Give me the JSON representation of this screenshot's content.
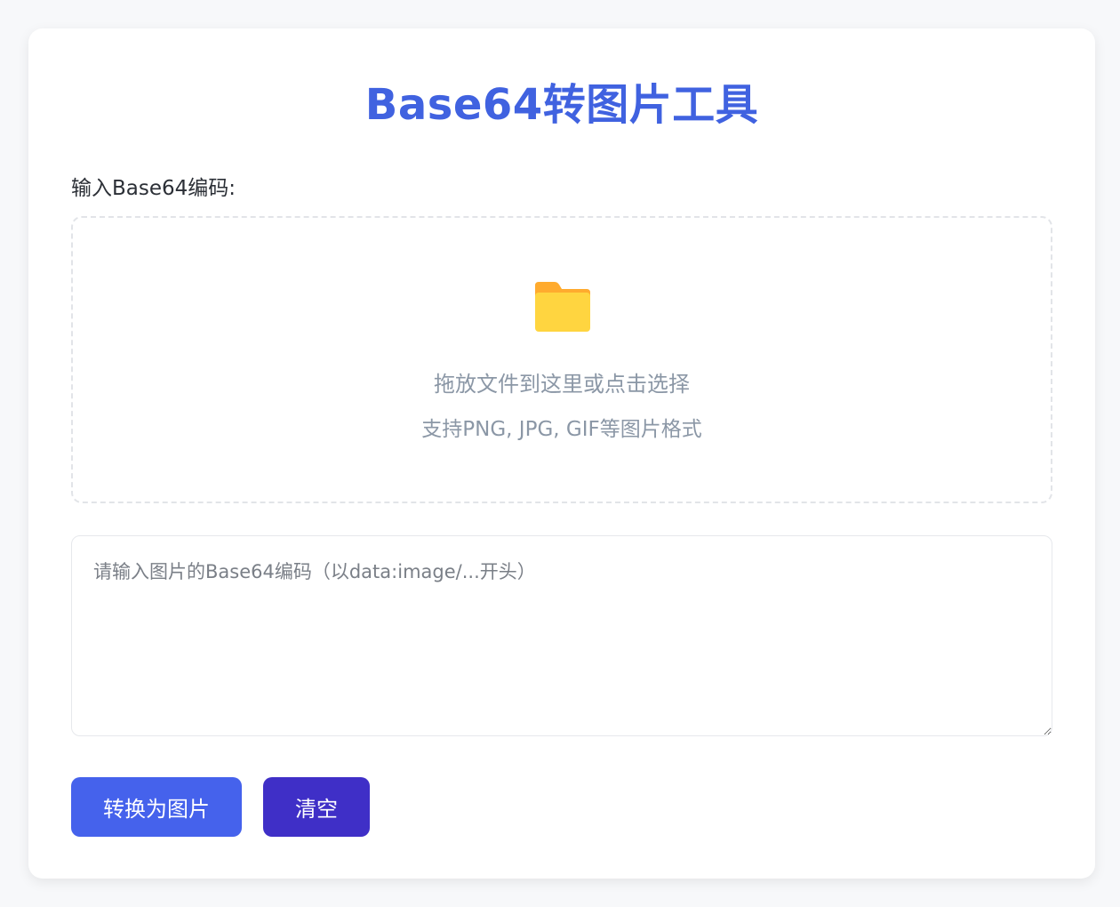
{
  "page": {
    "title": "Base64转图片工具"
  },
  "input": {
    "label": "输入Base64编码:"
  },
  "dropzone": {
    "icon": "folder-icon",
    "main_text": "拖放文件到这里或点击选择",
    "sub_text": "支持PNG, JPG, GIF等图片格式"
  },
  "textarea": {
    "value": "",
    "placeholder": "请输入图片的Base64编码（以data:image/...开头）"
  },
  "buttons": {
    "convert_label": "转换为图片",
    "clear_label": "清空"
  },
  "colors": {
    "accent": "#4062e0",
    "convert_button": "#4562ec",
    "clear_button": "#3f2fc7",
    "folder": "#ffd23f"
  }
}
